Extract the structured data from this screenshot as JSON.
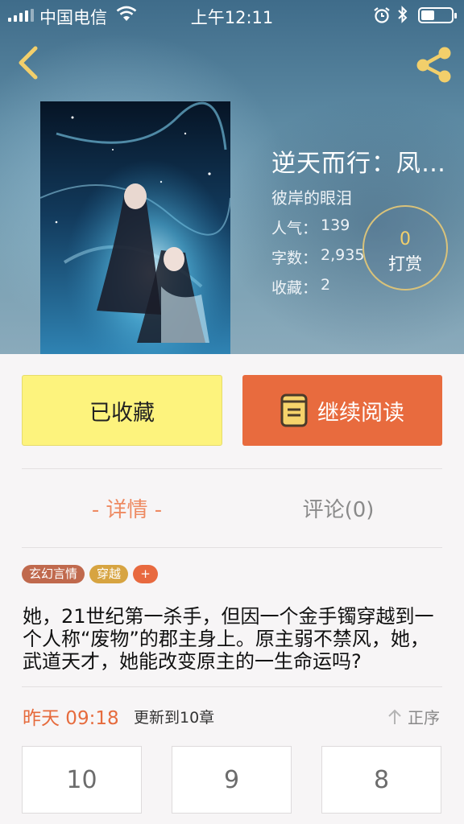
{
  "status_bar": {
    "carrier": "中国电信",
    "time": "上午12:11",
    "battery_level": 0.45
  },
  "book": {
    "title": "逆天而行：凤…",
    "author": "彼岸的眼泪",
    "popularity_label": "人气：",
    "popularity_value": "139",
    "wordcount_label": "字数：",
    "wordcount_value": "2,935",
    "collect_label": "收藏：",
    "collect_value": "2"
  },
  "tip": {
    "count": "0",
    "label": "打赏"
  },
  "actions": {
    "collected_label": "已收藏",
    "continue_label": "继续阅读"
  },
  "tabs": {
    "detail": "- 详情 -",
    "comments": "评论(0)"
  },
  "tags": [
    {
      "label": "玄幻言情",
      "color": "#c0694d"
    },
    {
      "label": "穿越",
      "color": "#d7a441"
    },
    {
      "label": "+",
      "color": "#e8693f"
    }
  ],
  "synopsis": "她，21世纪第一杀手，但因一个金手镯穿越到一个人称“废物”的郡主身上。原主弱不禁风，她，武道天才，她能改变原主的一生命运吗?",
  "update": {
    "time": "昨天 09:18",
    "text": "更新到10章",
    "sort_label": "正序"
  },
  "chapters": [
    "10",
    "9",
    "8"
  ],
  "colors": {
    "accent": "#e86b3e",
    "collected_bg": "#fdf37d",
    "icon_yellow": "#f2cf6b"
  }
}
